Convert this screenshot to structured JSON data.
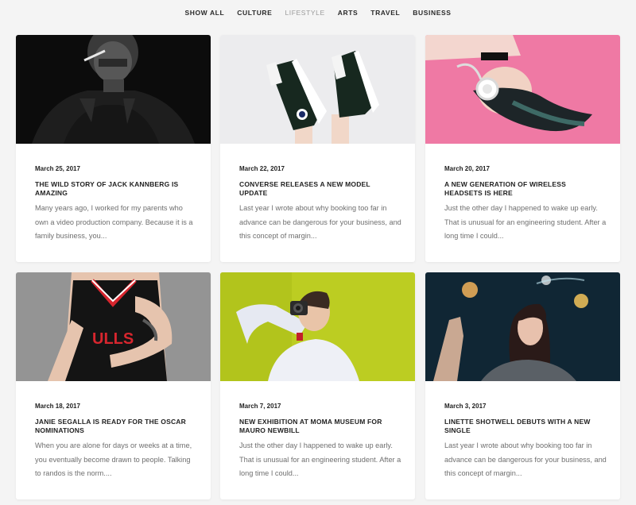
{
  "filters": [
    {
      "label": "SHOW ALL",
      "active": false
    },
    {
      "label": "CULTURE",
      "active": false
    },
    {
      "label": "LIFESTYLE",
      "active": true
    },
    {
      "label": "ARTS",
      "active": false
    },
    {
      "label": "TRAVEL",
      "active": false
    },
    {
      "label": "BUSINESS",
      "active": false
    }
  ],
  "posts": [
    {
      "image": "portrait-man-leather-jacket-smoking",
      "date": "March 25, 2017",
      "title": "THE WILD STORY OF JACK KANNBERG IS AMAZING",
      "excerpt": "Many years ago, I worked for my parents who own a video production company. Because it is a family business, you..."
    },
    {
      "image": "converse-sneakers-on-legs",
      "date": "March 22, 2017",
      "title": "CONVERSE RELEASES A NEW MODEL UPDATE",
      "excerpt": "Last year I wrote about why booking too far in advance can be dangerous for your business, and this concept of margin..."
    },
    {
      "image": "woman-headphones-pink-background",
      "date": "March 20, 2017",
      "title": "A NEW GENERATION OF WIRELESS HEADSETS IS HERE",
      "excerpt": "Just the other day I happened to wake up early. That is unusual for an engineering student. After a long time I could..."
    },
    {
      "image": "person-basketball-jersey-tattoo",
      "date": "March 18, 2017",
      "title": "JANIE SEGALLA IS READY FOR THE OSCAR NOMINATIONS",
      "excerpt": "When you are alone for days or weeks at a time, you eventually become drawn to people. Talking to randos is the norm...."
    },
    {
      "image": "man-with-camera-yellow-background",
      "date": "March 7, 2017",
      "title": "NEW EXHIBITION AT MOMA MUSEUM FOR MAURO NEWBILL",
      "excerpt": "Just the other day I happened to wake up early. That is unusual for an engineering student. After a long time I could..."
    },
    {
      "image": "woman-sparkler-night-lights",
      "date": "March 3, 2017",
      "title": "LINETTE SHOTWELL DEBUTS WITH A NEW SINGLE",
      "excerpt": "Last year I wrote about why booking too far in advance can be dangerous for your business, and this concept of margin..."
    }
  ]
}
